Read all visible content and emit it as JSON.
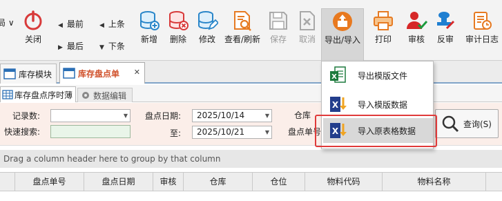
{
  "toolbar": {
    "partial_left": "局 ∨",
    "close": "关闭",
    "first": "最前",
    "last": "最后",
    "prev": "上条",
    "next": "下条",
    "add": "新增",
    "delete": "删除",
    "edit": "修改",
    "view_refresh": "查看/刷新",
    "save": "保存",
    "cancel": "取消",
    "export_import": "导出/导入",
    "print": "打印",
    "approve": "审核",
    "unapprove": "反审",
    "audit_log": "审计日志"
  },
  "tabs": [
    {
      "label": "库存模块"
    },
    {
      "label": "库存盘点单",
      "active": true
    }
  ],
  "subtabs": [
    {
      "label": "库存盘点序时薄"
    },
    {
      "label": "数据编辑"
    }
  ],
  "filter": {
    "record_count_label": "记录数:",
    "quick_search_label": "快速搜索:",
    "date_label": "盘点日期:",
    "date_from": "2025/10/14",
    "to_label": "至:",
    "date_to": "2025/10/21",
    "warehouse_label": "仓库",
    "order_no_label": "盘点单号",
    "query_button": "查询(S)"
  },
  "group_hint": "Drag a column header here to group by that column",
  "columns": [
    "盘点单号",
    "盘点日期",
    "审核",
    "仓库",
    "仓位",
    "物料代码",
    "物料名称"
  ],
  "dropdown": {
    "items": [
      {
        "label": "导出模版文件",
        "icon": "excel-export-icon"
      },
      {
        "label": "导入模版数据",
        "icon": "excel-import-icon"
      },
      {
        "label": "导入原表格数据",
        "icon": "excel-import-icon",
        "highlighted": true
      }
    ]
  },
  "colors": {
    "active_tab_text": "#d0502a",
    "highlight_box": "#e03a3a",
    "filter_bg": "#fbeee9"
  }
}
